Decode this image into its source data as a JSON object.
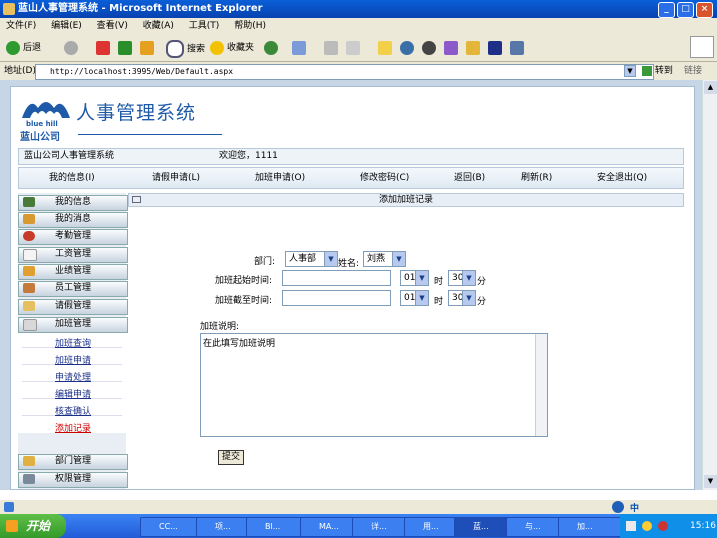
{
  "window": {
    "title": "蓝山人事管理系统 - Microsoft Internet Explorer",
    "buttons": {
      "minimize": "_",
      "maximize": "□",
      "close": "×"
    }
  },
  "menu": [
    "文件(F)",
    "编辑(E)",
    "查看(V)",
    "收藏(A)",
    "工具(T)",
    "帮助(H)"
  ],
  "toolbar": {
    "back": "后退",
    "search": "搜索",
    "favorites": "收藏夹"
  },
  "address": {
    "label": "地址(D)",
    "url": "http://localhost:3995/Web/Default.aspx",
    "go": "转到",
    "links": "链接"
  },
  "header": {
    "logo_text": "blue hill",
    "company": "蓝山公司",
    "system_title": "人事管理系统"
  },
  "infobar": {
    "system": "蓝山公司人事管理系统",
    "welcome": "欢迎您，1111"
  },
  "nav": [
    "我的信息(I)",
    "请假申请(L)",
    "加班申请(O)",
    "修改密码(C)",
    "返回(B)",
    "刷新(R)",
    "安全退出(Q)"
  ],
  "sidebar": {
    "items": [
      "我的信息",
      "我的消息",
      "考勤管理",
      "工资管理",
      "业绩管理",
      "员工管理",
      "请假管理",
      "加班管理"
    ],
    "submenu": [
      "加班查询",
      "加班申请",
      "申请处理",
      "编辑申请",
      "核查确认",
      "添加记录"
    ],
    "bottom_items": [
      "部门管理",
      "权限管理"
    ]
  },
  "form": {
    "heading": "添加加班记录",
    "dept_label": "部门:",
    "dept_value": "人事部",
    "name_label": "姓名:",
    "name_value": "刘燕",
    "start_label": "加班起始时间:",
    "end_label": "加班截至时间:",
    "hour_value": "01",
    "hour_unit": "时",
    "minute_value": "30",
    "minute_unit": "分",
    "desc_label": "加班说明:",
    "desc_value": "在此填写加班说明",
    "submit": "提交"
  },
  "taskbar": {
    "start": "开始",
    "tasks": [
      "CC...",
      "项...",
      "Bl...",
      "MA...",
      "详...",
      "用...",
      "蓝...",
      "与...",
      "加..."
    ],
    "time": "15:16",
    "ime": "中"
  },
  "colors": {
    "titlebar": "#0a5fd8",
    "page_bg": "#c6d6e6",
    "link": "#1a2f8a",
    "active_link": "#cc0000"
  }
}
